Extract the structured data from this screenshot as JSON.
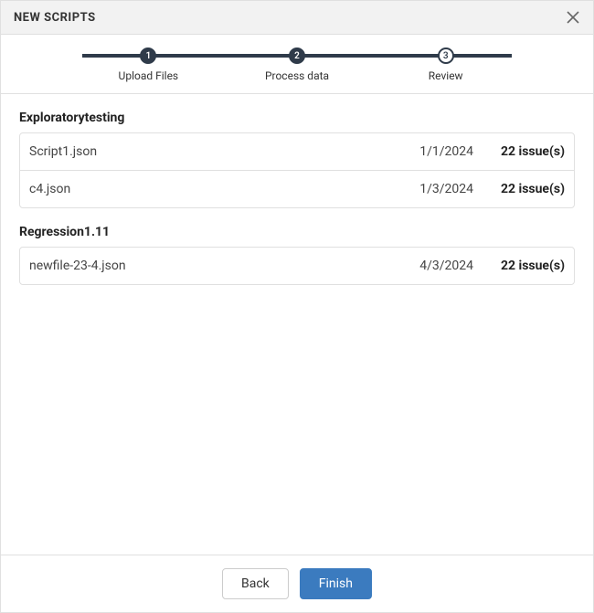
{
  "header": {
    "title": "NEW SCRIPTS"
  },
  "stepper": {
    "steps": [
      {
        "num": "1",
        "label": "Upload Files",
        "state": "filled"
      },
      {
        "num": "2",
        "label": "Process data",
        "state": "filled"
      },
      {
        "num": "3",
        "label": "Review",
        "state": "outlined"
      }
    ]
  },
  "groups": [
    {
      "title": "Exploratorytesting",
      "files": [
        {
          "name": "Script1.json",
          "date": "1/1/2024",
          "issues": "22 issue(s)"
        },
        {
          "name": "c4.json",
          "date": "1/3/2024",
          "issues": "22 issue(s)"
        }
      ]
    },
    {
      "title": "Regression1.11",
      "files": [
        {
          "name": "newfile-23-4.json",
          "date": "4/3/2024",
          "issues": "22 issue(s)"
        }
      ]
    }
  ],
  "footer": {
    "back_label": "Back",
    "finish_label": "Finish"
  }
}
